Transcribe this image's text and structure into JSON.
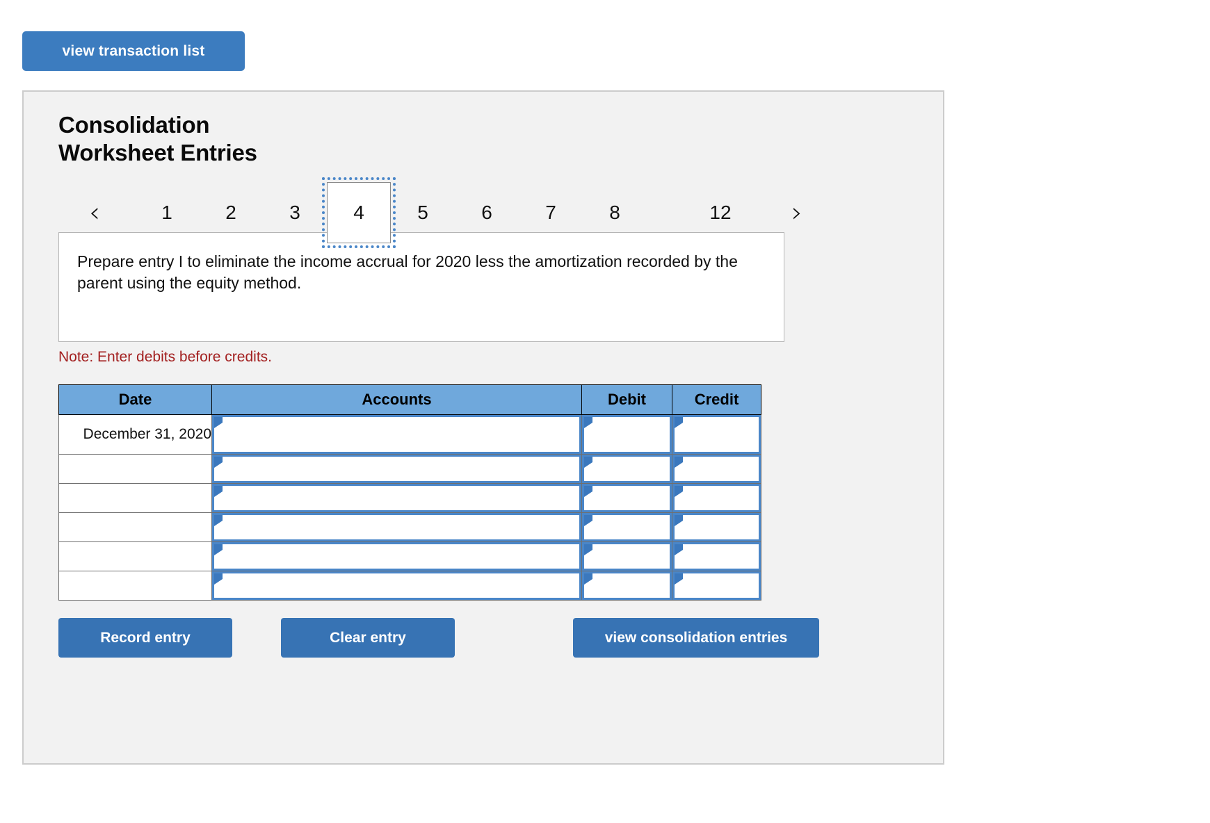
{
  "top": {
    "view_transaction_label": "view transaction list"
  },
  "panel": {
    "title_line1": "Consolidation",
    "title_line2": "Worksheet Entries"
  },
  "pagination": {
    "prev_icon": "chevron-left-icon",
    "next_icon": "chevron-right-icon",
    "prev_glyph": "‹",
    "next_glyph": "›",
    "selected": "4",
    "pages": [
      "1",
      "2",
      "3",
      "4",
      "5",
      "6",
      "7",
      "8",
      "12"
    ]
  },
  "instruction": {
    "text": "Prepare entry I to eliminate the income accrual for 2020 less the amortization recorded by the parent using the equity method."
  },
  "note": {
    "text": "Note: Enter debits before credits.",
    "color": "#a32020"
  },
  "journal": {
    "headers": [
      "Date",
      "Accounts",
      "Debit",
      "Credit"
    ],
    "header_bg": "#6fa8dc",
    "input_border_color": "#4a86c8",
    "rows": [
      {
        "date": "December 31, 2020",
        "accounts": "",
        "debit": "",
        "credit": ""
      },
      {
        "date": "",
        "accounts": "",
        "debit": "",
        "credit": ""
      },
      {
        "date": "",
        "accounts": "",
        "debit": "",
        "credit": ""
      },
      {
        "date": "",
        "accounts": "",
        "debit": "",
        "credit": ""
      },
      {
        "date": "",
        "accounts": "",
        "debit": "",
        "credit": ""
      },
      {
        "date": "",
        "accounts": "",
        "debit": "",
        "credit": ""
      }
    ]
  },
  "actions": {
    "record_label": "Record entry",
    "clear_label": "Clear entry",
    "view_consolidation_label": "view consolidation entries",
    "button_color": "#3773b4"
  }
}
